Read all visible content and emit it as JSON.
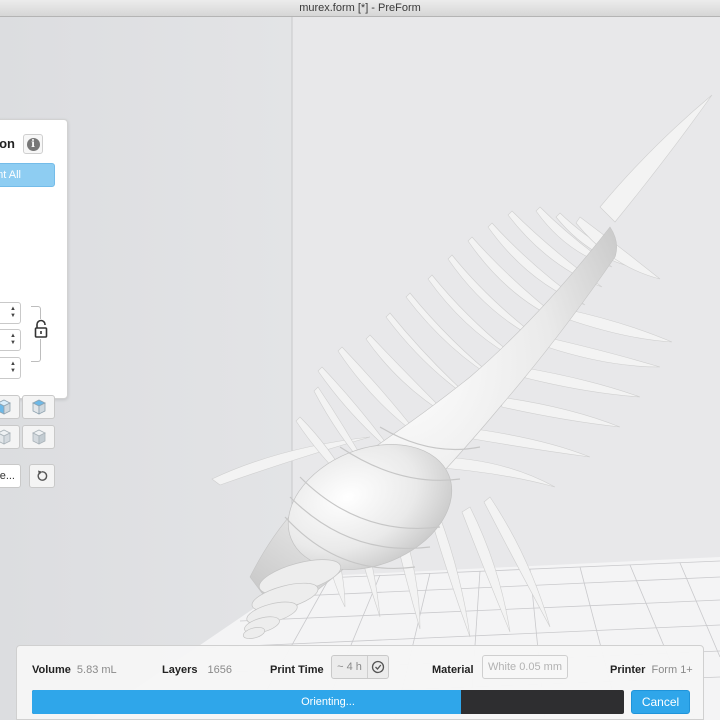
{
  "window": {
    "title": "murex.form [*] - PreForm"
  },
  "orientation_panel": {
    "title": "on",
    "orient_all_label": "nt All",
    "more_label": "e...",
    "icons": [
      "info-icon",
      "lock-icon",
      "cube-front-icon",
      "cube-top-icon",
      "cube-left-icon",
      "cube-back-icon",
      "reset-icon"
    ]
  },
  "status": {
    "volume_label": "Volume",
    "volume_value": "5.83 mL",
    "layers_label": "Layers",
    "layers_value": "1656",
    "print_time_label": "Print Time",
    "print_time_value": "~ 4 h",
    "material_label": "Material",
    "material_value": "White 0.05 mm",
    "printer_label": "Printer",
    "printer_value": "Form 1+"
  },
  "progress": {
    "label": "Orienting...",
    "fraction": 0.725
  },
  "cancel_label": "Cancel",
  "colors": {
    "accent": "#2fa6ea",
    "progress_track": "#2e2e30",
    "background": "#e2e3e5"
  }
}
